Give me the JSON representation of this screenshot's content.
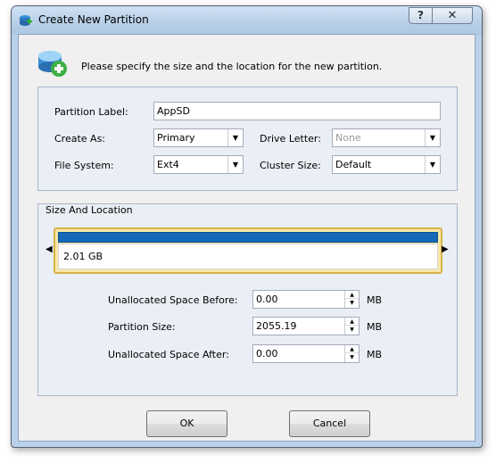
{
  "window": {
    "title": "Create New Partition",
    "help_glyph": "?",
    "close_glyph": "✕"
  },
  "header": {
    "instruction": "Please specify the size and the location for the new partition."
  },
  "form": {
    "partition_label": {
      "label": "Partition Label:",
      "value": "AppSD"
    },
    "create_as": {
      "label": "Create As:",
      "value": "Primary"
    },
    "drive_letter": {
      "label": "Drive Letter:",
      "value": "None",
      "disabled": true
    },
    "file_system": {
      "label": "File System:",
      "value": "Ext4"
    },
    "cluster_size": {
      "label": "Cluster Size:",
      "value": "Default"
    }
  },
  "size_location": {
    "group_title": "Size And Location",
    "bar": {
      "size_label": "2.01 GB",
      "fill_fraction": 1.0
    },
    "unalloc_before": {
      "label": "Unallocated Space Before:",
      "value": "0.00",
      "unit": "MB"
    },
    "partition_size": {
      "label": "Partition Size:",
      "value": "2055.19",
      "unit": "MB"
    },
    "unalloc_after": {
      "label": "Unallocated Space After:",
      "value": "0.00",
      "unit": "MB"
    }
  },
  "buttons": {
    "ok": "OK",
    "cancel": "Cancel"
  },
  "colors": {
    "accent_bar": "#1668b9",
    "frame": "#d8b24a",
    "window_chrome": "#b9d1ea"
  }
}
